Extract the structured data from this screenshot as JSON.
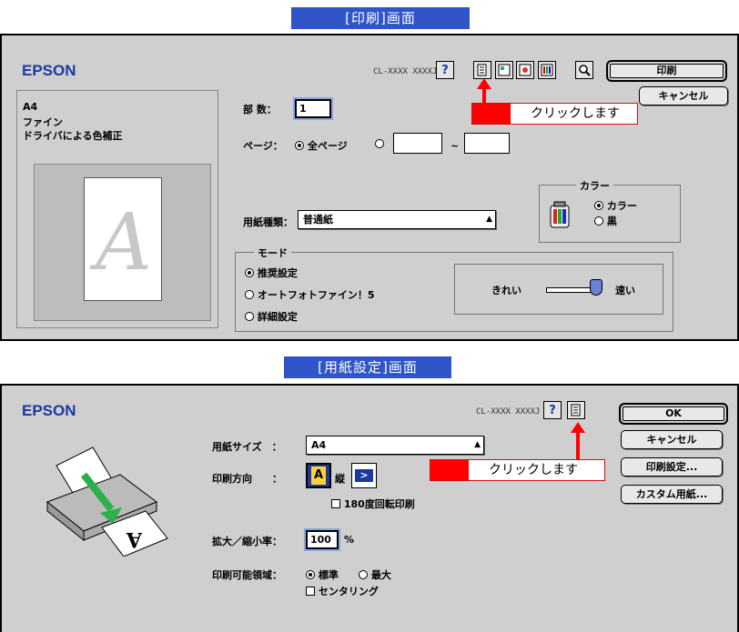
{
  "print_screen": {
    "banner": "[印刷]画面",
    "brand": "EPSON",
    "model": "CL-XXXX XXXXJ",
    "buttons": {
      "print": "印刷",
      "cancel": "キャンセル"
    },
    "summary": {
      "paper": "A4",
      "quality": "ファイン",
      "color_mode": "ドライバによる色補正",
      "preview_letter": "A"
    },
    "copies": {
      "label": "部 数：",
      "value": "1"
    },
    "pages": {
      "label": "ページ：",
      "all_label": "全ページ",
      "tilde": "~"
    },
    "media_type": {
      "label": "用紙種類：",
      "value": "普通紙"
    },
    "color": {
      "title": "カラー",
      "color_option": "カラー",
      "black_option": "黒"
    },
    "mode": {
      "title": "モード",
      "options": [
        "推奨設定",
        "オートフォトファイン！5",
        "詳細設定"
      ],
      "quality_label": "きれい",
      "speed_label": "速い"
    },
    "callout": "クリックします"
  },
  "page_setup_screen": {
    "banner": "[用紙設定]画面",
    "brand": "EPSON",
    "model": "CL-XXXX XXXXJ",
    "buttons": {
      "ok": "OK",
      "cancel": "キャンセル",
      "print_settings": "印刷設定...",
      "custom_paper": "カスタム用紙..."
    },
    "paper_size": {
      "label": "用紙サイズ　：",
      "value": "A4"
    },
    "orientation": {
      "label": "印刷方向　　：",
      "portrait": "縦",
      "rotate_180": "180度回転印刷"
    },
    "scale": {
      "label": "拡大／縮小率：",
      "value": "100",
      "unit": "%"
    },
    "printable_area": {
      "label": "印刷可能領域：",
      "standard": "標準",
      "maximum": "最大",
      "centering": "センタリング"
    },
    "callout": "クリックします"
  },
  "colors": {
    "banner": "#2f55c8",
    "panel": "#cfcfcf",
    "callout_red": "#ff0000",
    "brand": "#1a3aa0"
  }
}
